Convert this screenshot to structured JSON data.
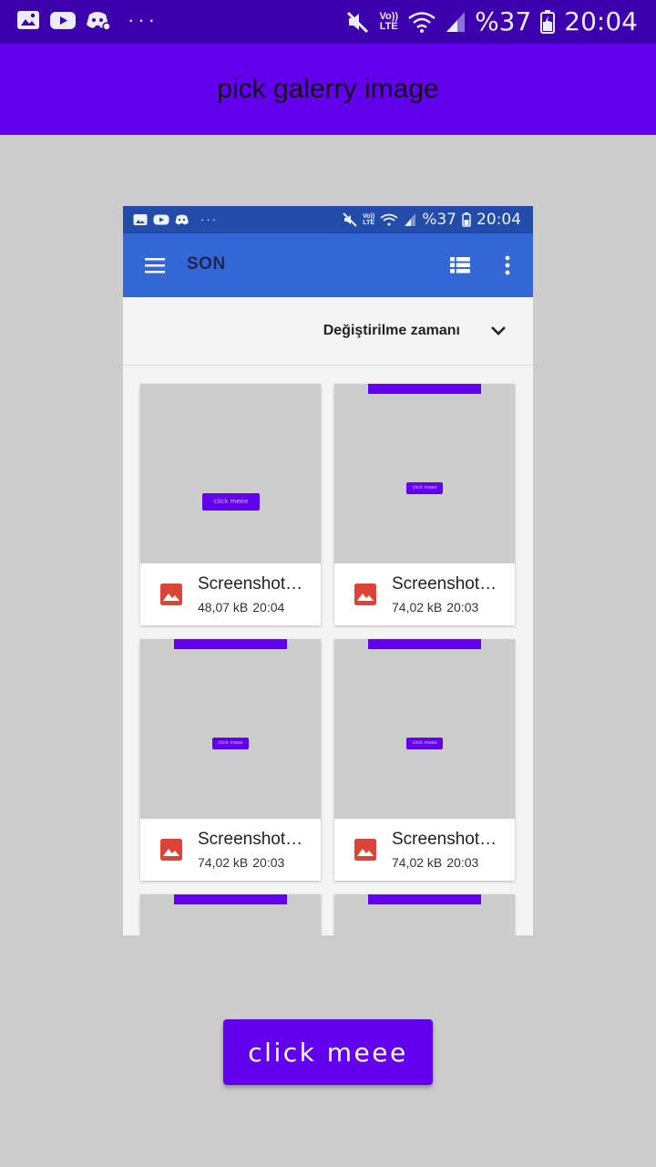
{
  "status_bar": {
    "battery": "%37",
    "time": "20:04",
    "volte_top": "Vo))",
    "volte_bottom": "LTE",
    "overflow": "···",
    "icons": [
      "gallery-icon",
      "youtube-icon",
      "discord-icon",
      "mute-icon",
      "wifi-icon",
      "signal-icon",
      "battery-icon"
    ]
  },
  "app_bar": {
    "title": "pick galerry image"
  },
  "picker": {
    "status_bar": {
      "battery": "%37",
      "time": "20:04",
      "volte_top": "Vo))",
      "volte_bottom": "LTE",
      "overflow": "···"
    },
    "toolbar": {
      "title": "SON"
    },
    "sort": {
      "label": "Değiştirilme zamanı"
    },
    "mini_button_label": "click meee",
    "files": [
      {
        "name": "Screenshot…",
        "size": "48,07 kB",
        "time": "20:04"
      },
      {
        "name": "Screenshot…",
        "size": "74,02 kB",
        "time": "20:03"
      },
      {
        "name": "Screenshot…",
        "size": "74,02 kB",
        "time": "20:03"
      },
      {
        "name": "Screenshot…",
        "size": "74,02 kB",
        "time": "20:03"
      }
    ]
  },
  "main_button": {
    "label": "click meee"
  },
  "colors": {
    "status_bar": "#3d00ad",
    "app_bar": "#6200ee",
    "background": "#cccccc",
    "picker_toolbar": "#3367d6",
    "picker_status": "#234ba8",
    "image_icon": "#db4437"
  }
}
